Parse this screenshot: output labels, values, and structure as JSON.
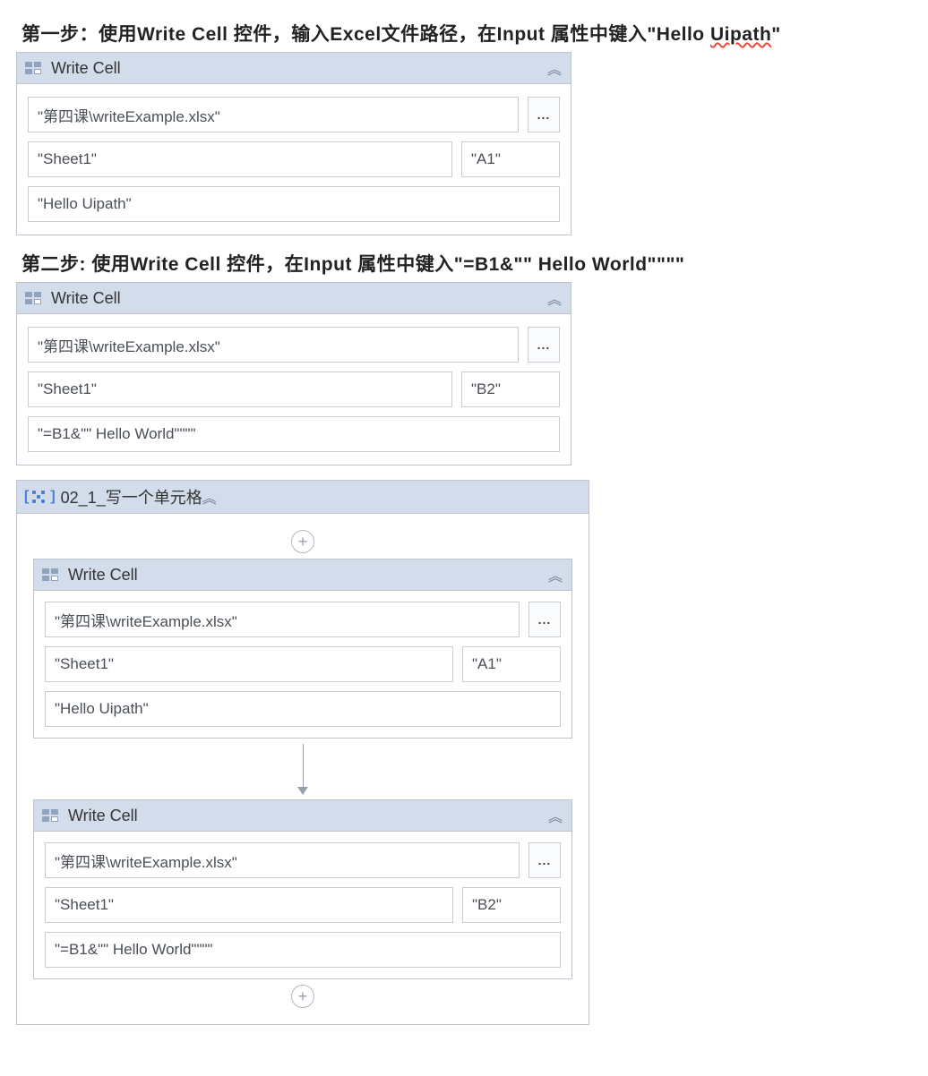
{
  "step1": {
    "text_prefix": "第一步：使用Write Cell 控件，输入Excel文件路径，在Input 属性中键入\"Hello ",
    "text_squiggle": "Uipath",
    "text_suffix": "\"",
    "panel_title": "Write Cell",
    "file": "\"第四课\\writeExample.xlsx\"",
    "sheet": "\"Sheet1\"",
    "cell": "\"A1\"",
    "value": "\"Hello Uipath\"",
    "browse": "..."
  },
  "step2": {
    "text": "第二步:  使用Write Cell 控件，在Input 属性中键入\"=B1&\"\" Hello World\"\"\"\"",
    "panel_title": "Write Cell",
    "file": "\"第四课\\writeExample.xlsx\"",
    "sheet": "\"Sheet1\"",
    "cell": "\"B2\"",
    "value": "\"=B1&\"\" Hello World\"\"\"\"",
    "browse": "..."
  },
  "sequence": {
    "title": "02_1_写一个单元格",
    "activities": [
      {
        "title": "Write Cell",
        "file": "\"第四课\\writeExample.xlsx\"",
        "sheet": "\"Sheet1\"",
        "cell": "\"A1\"",
        "value": "\"Hello Uipath\"",
        "browse": "..."
      },
      {
        "title": "Write Cell",
        "file": "\"第四课\\writeExample.xlsx\"",
        "sheet": "\"Sheet1\"",
        "cell": "\"B2\"",
        "value": "\"=B1&\"\" Hello World\"\"\"\"",
        "browse": "..."
      }
    ]
  },
  "icons": {
    "collapse": "︽"
  }
}
